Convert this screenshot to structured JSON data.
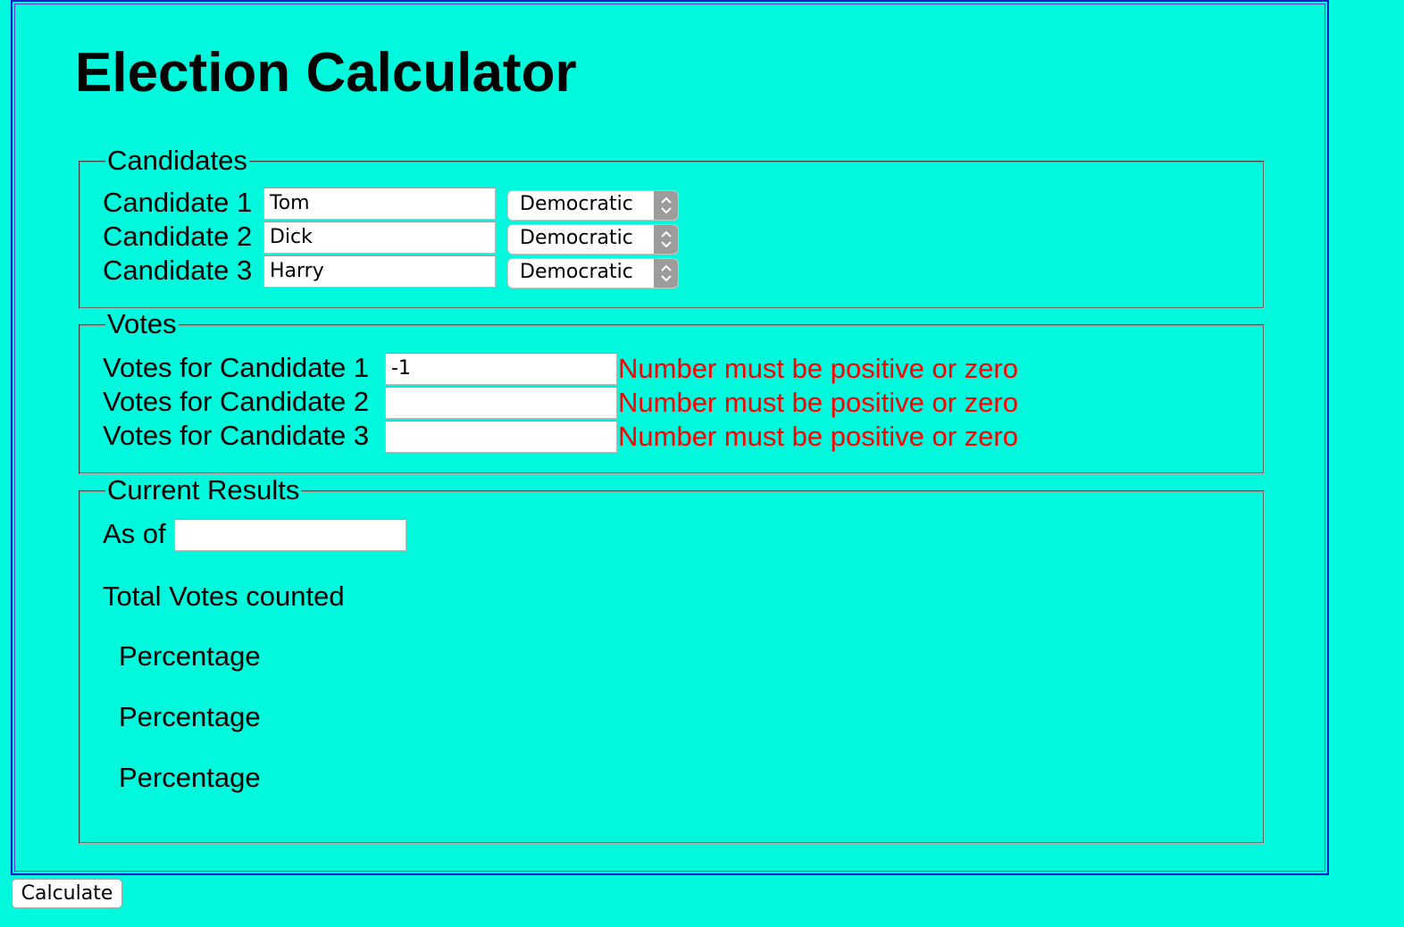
{
  "page": {
    "title": "Election Calculator"
  },
  "candidates_section": {
    "legend": "Candidates",
    "rows": [
      {
        "label": "Candidate 1",
        "name_value": "Tom",
        "party_value": "Democratic"
      },
      {
        "label": "Candidate 2",
        "name_value": "Dick",
        "party_value": "Democratic"
      },
      {
        "label": "Candidate 3",
        "name_value": "Harry",
        "party_value": "Democratic"
      }
    ]
  },
  "votes_section": {
    "legend": "Votes",
    "rows": [
      {
        "label": "Votes for Candidate 1",
        "value": "-1",
        "error": "Number must be positive or zero"
      },
      {
        "label": "Votes for Candidate 2",
        "value": "",
        "error": "Number must be positive or zero"
      },
      {
        "label": "Votes for Candidate 3",
        "value": "",
        "error": "Number must be positive or zero"
      }
    ]
  },
  "results_section": {
    "legend": "Current Results",
    "as_of_label": "As of",
    "as_of_value": "",
    "total_votes_label": "Total Votes counted",
    "percentage_labels": [
      "Percentage",
      "Percentage",
      "Percentage"
    ]
  },
  "actions": {
    "calculate_label": "Calculate"
  },
  "colors": {
    "background": "#00f8dc",
    "frame_border": "#1f1ccc",
    "error_text": "#ff0000"
  }
}
